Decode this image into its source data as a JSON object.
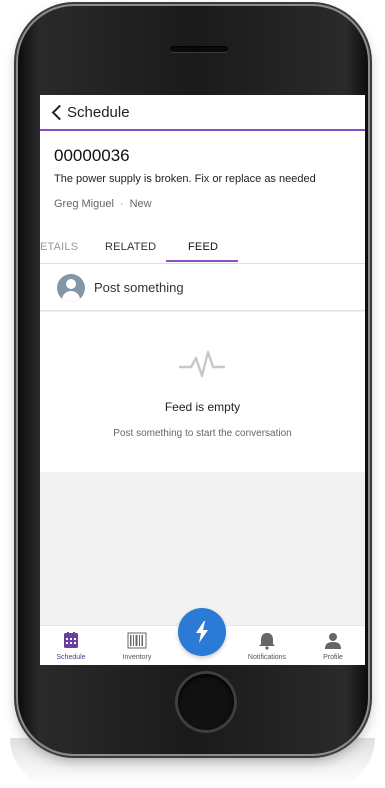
{
  "nav": {
    "back_icon": "chevron-left-icon",
    "title": "Schedule"
  },
  "record": {
    "number": "00000036",
    "subject": "The power supply is broken. Fix or replace as needed",
    "owner": "Greg Miguel",
    "separator": "·",
    "status": "New"
  },
  "tabs": [
    {
      "label": "ETAILS"
    },
    {
      "label": "RELATED"
    },
    {
      "label": "FEED",
      "active": true
    }
  ],
  "composer": {
    "icon": "user-avatar-icon",
    "label": "Post something"
  },
  "feed": {
    "icon": "pulse-icon",
    "empty_title": "Feed is empty",
    "empty_subtitle": "Post something to start the conversation"
  },
  "tab_bar": {
    "items": [
      {
        "label": "Schedule",
        "icon": "calendar-icon",
        "active": true
      },
      {
        "label": "Inventory",
        "icon": "barcode-icon"
      },
      {
        "label": "Notifications",
        "icon": "bell-icon"
      },
      {
        "label": "Profile",
        "icon": "person-icon"
      }
    ],
    "action_icon": "lightning-bolt-icon"
  },
  "colors": {
    "accent": "#8a4fc8",
    "action": "#2a7ad6",
    "avatar": "#8597a6",
    "active_tab_icon": "#6b3fa0"
  }
}
